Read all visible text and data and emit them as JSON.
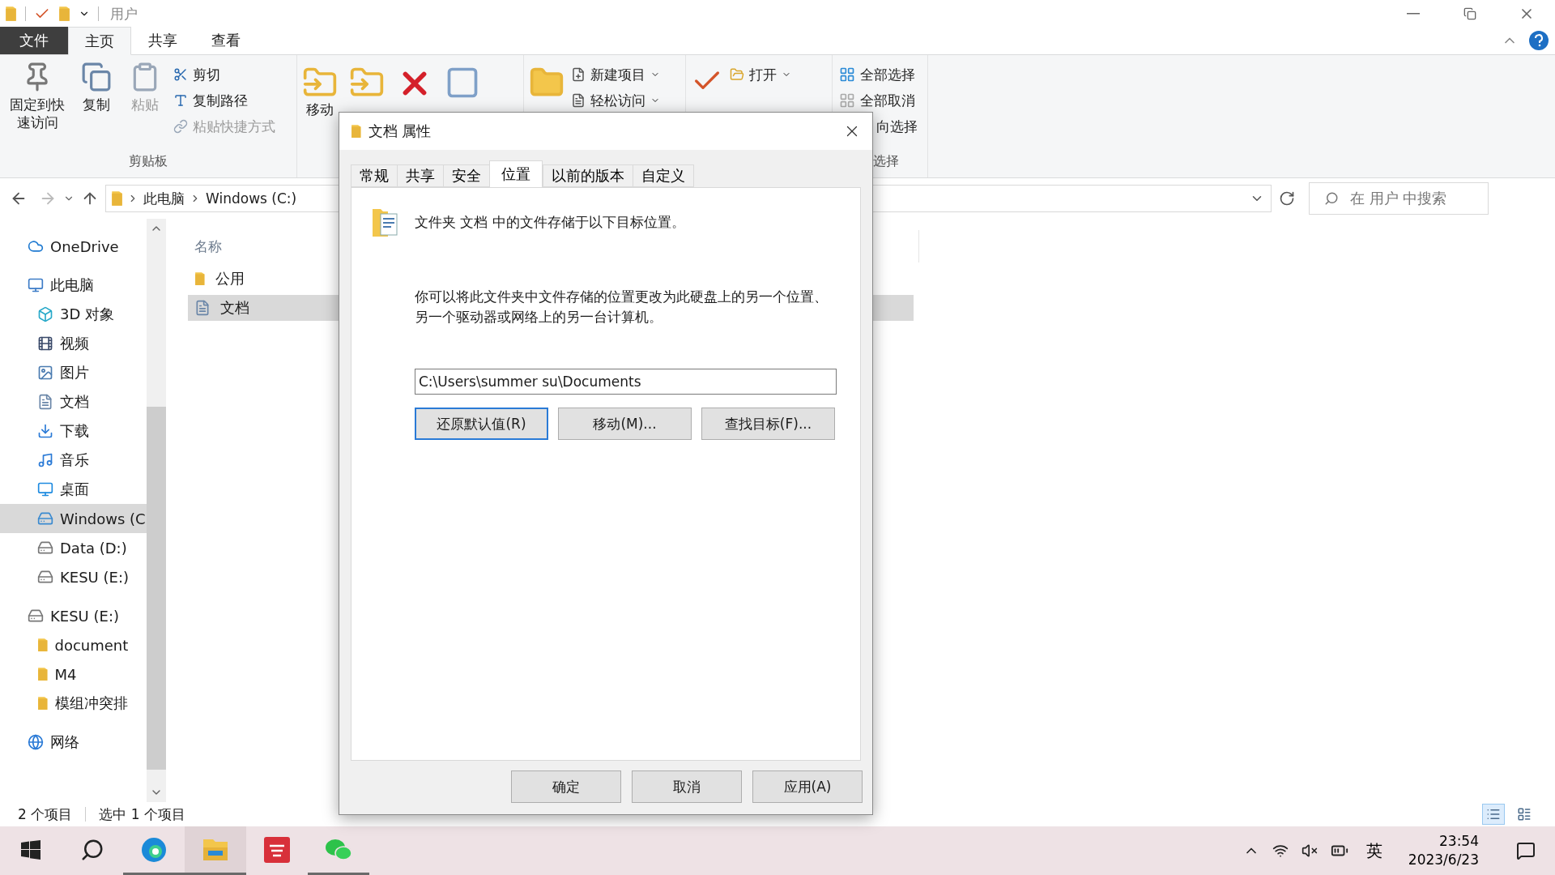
{
  "title_bar": {
    "title": "用户"
  },
  "ribbon": {
    "file_tab": "文件",
    "tabs": [
      {
        "label": "主页",
        "selected": true
      },
      {
        "label": "共享",
        "selected": false
      },
      {
        "label": "查看",
        "selected": false
      }
    ],
    "clipboard": {
      "label": "剪贴板",
      "large": [
        {
          "kind": "pin",
          "label": "固定到快速访问",
          "disabled": false
        },
        {
          "kind": "copy",
          "label": "复制",
          "disabled": false
        },
        {
          "kind": "paste",
          "label": "粘贴",
          "disabled": true
        }
      ],
      "small": [
        {
          "kind": "cut",
          "label": "剪切",
          "disabled": false
        },
        {
          "kind": "copy_path",
          "label": "复制路径",
          "disabled": false
        },
        {
          "kind": "paste_shortcut",
          "label": "粘贴快捷方式",
          "disabled": true
        }
      ]
    },
    "organize": {
      "move_label": "移动"
    },
    "new": {
      "items": [
        {
          "kind": "new_item",
          "label": "新建项目"
        },
        {
          "kind": "easy_access",
          "label": "轻松访问"
        }
      ]
    },
    "open": {
      "items": [
        {
          "kind": "open",
          "label": "打开"
        }
      ]
    },
    "select": {
      "label": "选择",
      "items": [
        {
          "kind": "select_all",
          "label": "全部选择"
        },
        {
          "kind": "select_none",
          "label": "全部取消"
        },
        {
          "kind": "invert",
          "label": "向选择"
        }
      ]
    }
  },
  "address": {
    "crumbs": [
      "此电脑",
      "Windows (C:)"
    ],
    "search_placeholder": "在 用户 中搜索"
  },
  "nav": {
    "items": [
      {
        "kind": "cloud",
        "label": "OneDrive",
        "selected": false
      },
      {
        "kind": "pc",
        "label": "此电脑",
        "selected": false,
        "children": [
          {
            "kind": "objects3d",
            "label": "3D 对象",
            "selected": false
          },
          {
            "kind": "video",
            "label": "视频",
            "selected": false
          },
          {
            "kind": "pictures",
            "label": "图片",
            "selected": false
          },
          {
            "kind": "document",
            "label": "文档",
            "selected": false
          },
          {
            "kind": "download",
            "label": "下载",
            "selected": false
          },
          {
            "kind": "music",
            "label": "音乐",
            "selected": false
          },
          {
            "kind": "desktop",
            "label": "桌面",
            "selected": false
          },
          {
            "kind": "windows_drive",
            "label": "Windows (C",
            "selected": true
          },
          {
            "kind": "drive",
            "label": "Data (D:)",
            "selected": false
          },
          {
            "kind": "drive",
            "label": "KESU (E:)",
            "selected": false
          }
        ]
      },
      {
        "kind": "drive",
        "label": "KESU (E:)",
        "selected": false,
        "children": [
          {
            "kind": "folder",
            "label": "document",
            "selected": false
          },
          {
            "kind": "folder",
            "label": "M4",
            "selected": false
          },
          {
            "kind": "folder",
            "label": "模组冲突排",
            "selected": false
          }
        ]
      },
      {
        "kind": "network",
        "label": "网络",
        "selected": false
      }
    ]
  },
  "files": {
    "column": "名称",
    "rows": [
      {
        "kind": "folder",
        "name": "公用",
        "selected": false
      },
      {
        "kind": "document",
        "name": "文档",
        "selected": true
      }
    ]
  },
  "status_bar": {
    "count": "2 个项目",
    "selection": "选中 1 个项目"
  },
  "taskbar": {
    "apps": [
      {
        "kind": "edge",
        "running": true,
        "active": false
      },
      {
        "kind": "explorer",
        "running": true,
        "active": true
      },
      {
        "kind": "app",
        "running": false,
        "active": false
      },
      {
        "kind": "chat",
        "running": true,
        "active": false
      }
    ],
    "language": "英",
    "time": "23:54",
    "date": "2023/6/23"
  },
  "dialog": {
    "title": "文档 属性",
    "tabs": [
      {
        "label": "常规",
        "selected": false
      },
      {
        "label": "共享",
        "selected": false
      },
      {
        "label": "安全",
        "selected": false
      },
      {
        "label": "位置",
        "selected": true
      },
      {
        "label": "以前的版本",
        "selected": false
      },
      {
        "label": "自定义",
        "selected": false
      }
    ],
    "heading": "文件夹 文档 中的文件存储于以下目标位置。",
    "description": "你可以将此文件夹中文件存储的位置更改为此硬盘上的另一个位置、另一个驱动器或网络上的另一台计算机。",
    "path": "C:\\Users\\summer su\\Documents",
    "actions": [
      {
        "label": "还原默认值(R)",
        "default": true
      },
      {
        "label": "移动(M)...",
        "default": false
      },
      {
        "label": "查找目标(F)...",
        "default": false
      }
    ],
    "buttons": [
      "确定",
      "取消",
      "应用(A)"
    ]
  }
}
